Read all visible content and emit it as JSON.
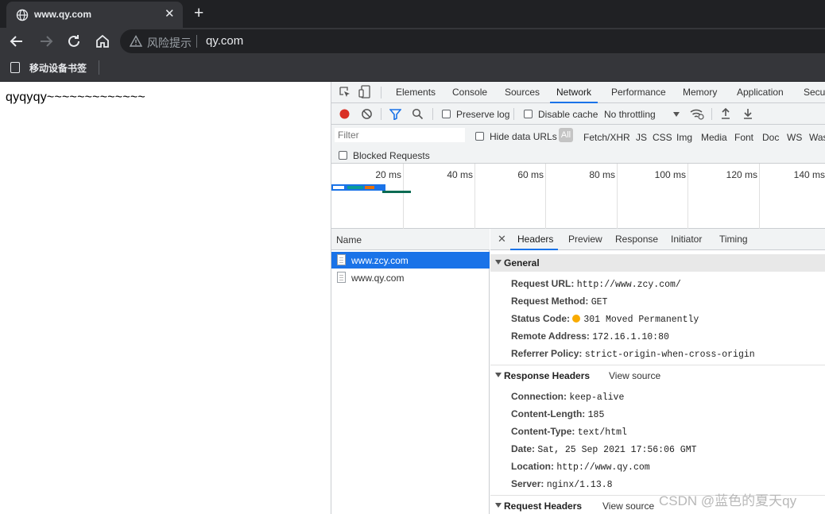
{
  "browser": {
    "tab_title": "www.qy.com",
    "tab_close": "✕",
    "new_tab": "+",
    "risk_label": "风险提示",
    "address": "qy.com",
    "bookmark_label": "移动设备书签"
  },
  "page": {
    "content": "qyqyqy~~~~~~~~~~~~~"
  },
  "devtools": {
    "tabs": [
      "Elements",
      "Console",
      "Sources",
      "Network",
      "Performance",
      "Memory",
      "Application",
      "Secu"
    ],
    "active_tab": "Network",
    "toolbar": {
      "preserve_log": "Preserve log",
      "disable_cache": "Disable cache",
      "throttling": "No throttling"
    },
    "filter": {
      "placeholder": "Filter",
      "hide_data_urls": "Hide data URLs",
      "all": "All",
      "types": [
        "Fetch/XHR",
        "JS",
        "CSS",
        "Img",
        "Media",
        "Font",
        "Doc",
        "WS",
        "Was"
      ],
      "blocked_requests": "Blocked Requests"
    },
    "timeline_ticks": [
      "20 ms",
      "40 ms",
      "60 ms",
      "80 ms",
      "100 ms",
      "120 ms",
      "140 ms"
    ],
    "name_column": "Name",
    "requests": [
      {
        "name": "www.zcy.com",
        "selected": true
      },
      {
        "name": "www.qy.com",
        "selected": false
      }
    ],
    "detail_tabs": [
      "Headers",
      "Preview",
      "Response",
      "Initiator",
      "Timing"
    ],
    "active_detail_tab": "Headers",
    "general": {
      "title": "General",
      "rows": [
        {
          "key": "Request URL:",
          "value": "http://www.zcy.com/"
        },
        {
          "key": "Request Method:",
          "value": "GET"
        },
        {
          "key": "Status Code:",
          "value": "301 Moved Permanently"
        },
        {
          "key": "Remote Address:",
          "value": "172.16.1.10:80"
        },
        {
          "key": "Referrer Policy:",
          "value": "strict-origin-when-cross-origin"
        }
      ]
    },
    "response_headers": {
      "title": "Response Headers",
      "view_source": "View source",
      "rows": [
        {
          "key": "Connection:",
          "value": "keep-alive"
        },
        {
          "key": "Content-Length:",
          "value": "185"
        },
        {
          "key": "Content-Type:",
          "value": "text/html"
        },
        {
          "key": "Date:",
          "value": "Sat, 25 Sep 2021 17:56:06 GMT"
        },
        {
          "key": "Location:",
          "value": "http://www.qy.com"
        },
        {
          "key": "Server:",
          "value": "nginx/1.13.8"
        }
      ]
    },
    "request_headers": {
      "title": "Request Headers",
      "view_source": "View source"
    }
  },
  "watermark": "CSDN @蓝色的夏天qy",
  "colors": {
    "accent": "#1a73e8",
    "record": "#d93025",
    "status_301": "#f9ab00"
  }
}
